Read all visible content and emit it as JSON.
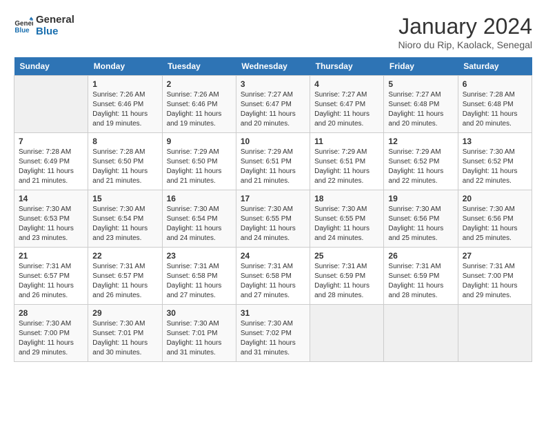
{
  "logo": {
    "line1": "General",
    "line2": "Blue"
  },
  "title": "January 2024",
  "location": "Nioro du Rip, Kaolack, Senegal",
  "weekdays": [
    "Sunday",
    "Monday",
    "Tuesday",
    "Wednesday",
    "Thursday",
    "Friday",
    "Saturday"
  ],
  "weeks": [
    [
      {
        "day": "",
        "info": ""
      },
      {
        "day": "1",
        "info": "Sunrise: 7:26 AM\nSunset: 6:46 PM\nDaylight: 11 hours\nand 19 minutes."
      },
      {
        "day": "2",
        "info": "Sunrise: 7:26 AM\nSunset: 6:46 PM\nDaylight: 11 hours\nand 19 minutes."
      },
      {
        "day": "3",
        "info": "Sunrise: 7:27 AM\nSunset: 6:47 PM\nDaylight: 11 hours\nand 20 minutes."
      },
      {
        "day": "4",
        "info": "Sunrise: 7:27 AM\nSunset: 6:47 PM\nDaylight: 11 hours\nand 20 minutes."
      },
      {
        "day": "5",
        "info": "Sunrise: 7:27 AM\nSunset: 6:48 PM\nDaylight: 11 hours\nand 20 minutes."
      },
      {
        "day": "6",
        "info": "Sunrise: 7:28 AM\nSunset: 6:48 PM\nDaylight: 11 hours\nand 20 minutes."
      }
    ],
    [
      {
        "day": "7",
        "info": "Sunrise: 7:28 AM\nSunset: 6:49 PM\nDaylight: 11 hours\nand 21 minutes."
      },
      {
        "day": "8",
        "info": "Sunrise: 7:28 AM\nSunset: 6:50 PM\nDaylight: 11 hours\nand 21 minutes."
      },
      {
        "day": "9",
        "info": "Sunrise: 7:29 AM\nSunset: 6:50 PM\nDaylight: 11 hours\nand 21 minutes."
      },
      {
        "day": "10",
        "info": "Sunrise: 7:29 AM\nSunset: 6:51 PM\nDaylight: 11 hours\nand 21 minutes."
      },
      {
        "day": "11",
        "info": "Sunrise: 7:29 AM\nSunset: 6:51 PM\nDaylight: 11 hours\nand 22 minutes."
      },
      {
        "day": "12",
        "info": "Sunrise: 7:29 AM\nSunset: 6:52 PM\nDaylight: 11 hours\nand 22 minutes."
      },
      {
        "day": "13",
        "info": "Sunrise: 7:30 AM\nSunset: 6:52 PM\nDaylight: 11 hours\nand 22 minutes."
      }
    ],
    [
      {
        "day": "14",
        "info": "Sunrise: 7:30 AM\nSunset: 6:53 PM\nDaylight: 11 hours\nand 23 minutes."
      },
      {
        "day": "15",
        "info": "Sunrise: 7:30 AM\nSunset: 6:54 PM\nDaylight: 11 hours\nand 23 minutes."
      },
      {
        "day": "16",
        "info": "Sunrise: 7:30 AM\nSunset: 6:54 PM\nDaylight: 11 hours\nand 24 minutes."
      },
      {
        "day": "17",
        "info": "Sunrise: 7:30 AM\nSunset: 6:55 PM\nDaylight: 11 hours\nand 24 minutes."
      },
      {
        "day": "18",
        "info": "Sunrise: 7:30 AM\nSunset: 6:55 PM\nDaylight: 11 hours\nand 24 minutes."
      },
      {
        "day": "19",
        "info": "Sunrise: 7:30 AM\nSunset: 6:56 PM\nDaylight: 11 hours\nand 25 minutes."
      },
      {
        "day": "20",
        "info": "Sunrise: 7:30 AM\nSunset: 6:56 PM\nDaylight: 11 hours\nand 25 minutes."
      }
    ],
    [
      {
        "day": "21",
        "info": "Sunrise: 7:31 AM\nSunset: 6:57 PM\nDaylight: 11 hours\nand 26 minutes."
      },
      {
        "day": "22",
        "info": "Sunrise: 7:31 AM\nSunset: 6:57 PM\nDaylight: 11 hours\nand 26 minutes."
      },
      {
        "day": "23",
        "info": "Sunrise: 7:31 AM\nSunset: 6:58 PM\nDaylight: 11 hours\nand 27 minutes."
      },
      {
        "day": "24",
        "info": "Sunrise: 7:31 AM\nSunset: 6:58 PM\nDaylight: 11 hours\nand 27 minutes."
      },
      {
        "day": "25",
        "info": "Sunrise: 7:31 AM\nSunset: 6:59 PM\nDaylight: 11 hours\nand 28 minutes."
      },
      {
        "day": "26",
        "info": "Sunrise: 7:31 AM\nSunset: 6:59 PM\nDaylight: 11 hours\nand 28 minutes."
      },
      {
        "day": "27",
        "info": "Sunrise: 7:31 AM\nSunset: 7:00 PM\nDaylight: 11 hours\nand 29 minutes."
      }
    ],
    [
      {
        "day": "28",
        "info": "Sunrise: 7:30 AM\nSunset: 7:00 PM\nDaylight: 11 hours\nand 29 minutes."
      },
      {
        "day": "29",
        "info": "Sunrise: 7:30 AM\nSunset: 7:01 PM\nDaylight: 11 hours\nand 30 minutes."
      },
      {
        "day": "30",
        "info": "Sunrise: 7:30 AM\nSunset: 7:01 PM\nDaylight: 11 hours\nand 31 minutes."
      },
      {
        "day": "31",
        "info": "Sunrise: 7:30 AM\nSunset: 7:02 PM\nDaylight: 11 hours\nand 31 minutes."
      },
      {
        "day": "",
        "info": ""
      },
      {
        "day": "",
        "info": ""
      },
      {
        "day": "",
        "info": ""
      }
    ]
  ]
}
